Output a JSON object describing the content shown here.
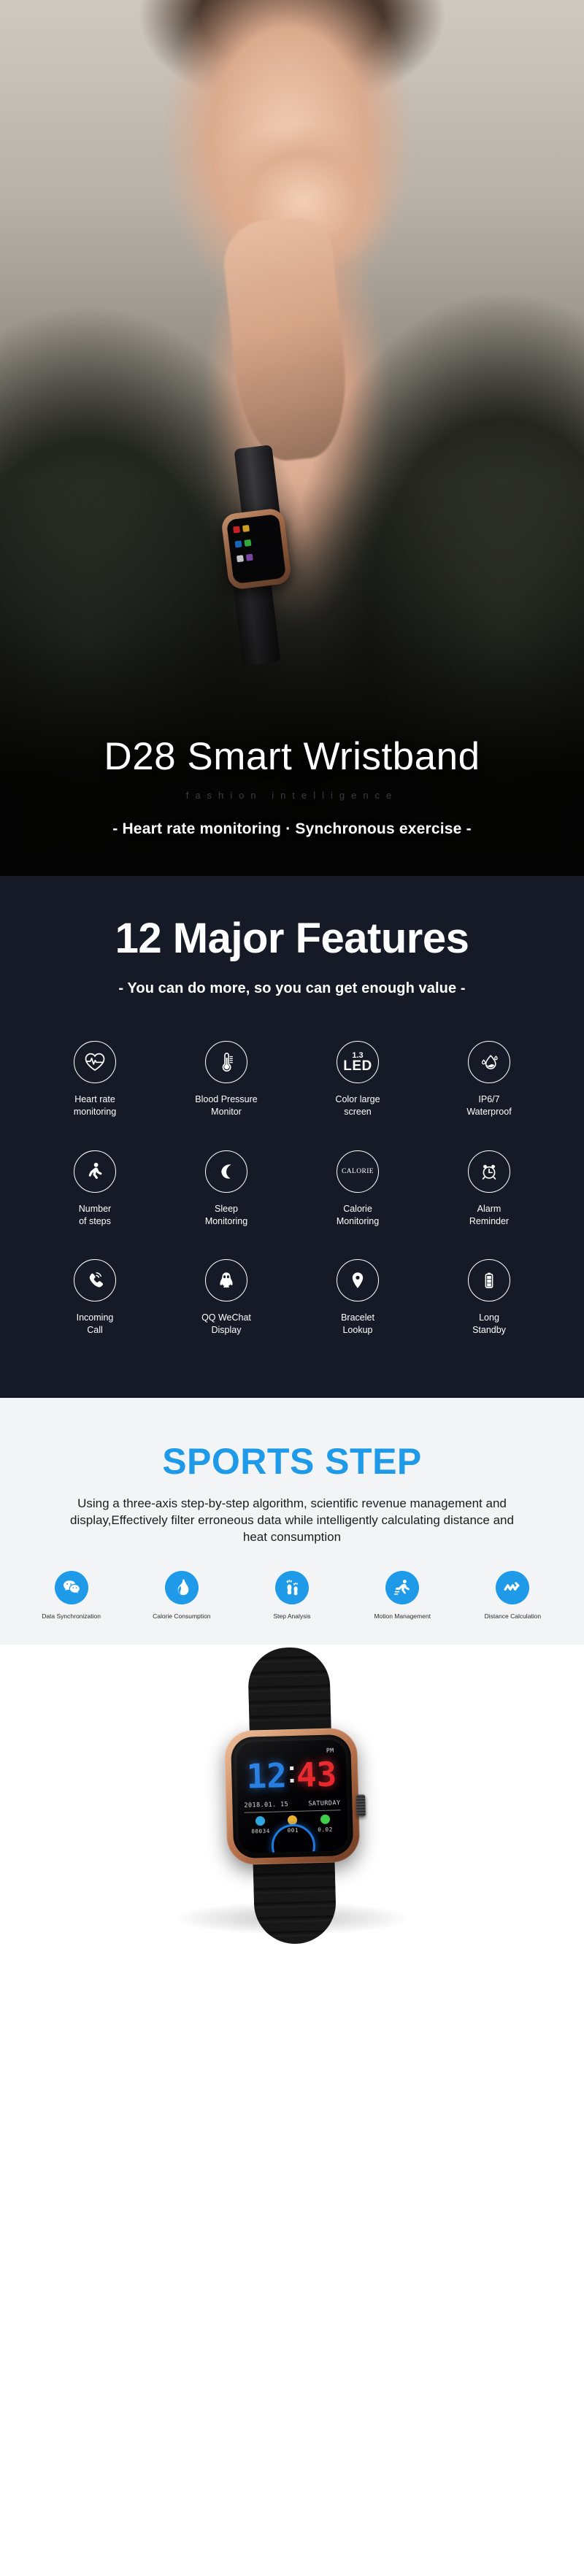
{
  "hero": {
    "title": "D28 Smart Wristband",
    "subtitle_faint": "fashion intelligence",
    "tagline": "- Heart rate monitoring · Synchronous exercise -"
  },
  "features_section": {
    "title": "12 Major Features",
    "subtitle": "- You can do more, so you can get enough value -",
    "background_color": "#151a26",
    "items": [
      {
        "icon": "heart-rate-icon",
        "label": "Heart rate\nmonitoring"
      },
      {
        "icon": "thermometer-icon",
        "label": "Blood Pressure\nMonitor"
      },
      {
        "icon": "led-screen-icon",
        "label": "Color large\nscreen",
        "icon_text_top": "1.3",
        "icon_text_main": "LED"
      },
      {
        "icon": "water-drop-icon",
        "label": "IP6/7\nWaterproof"
      },
      {
        "icon": "walking-person-icon",
        "label": "Number\nof steps"
      },
      {
        "icon": "crescent-moon-icon",
        "label": "Sleep\nMonitoring"
      },
      {
        "icon": "calorie-icon",
        "label": "Calorie\nMonitoring",
        "icon_text_main": "CALORIE"
      },
      {
        "icon": "alarm-clock-icon",
        "label": "Alarm\nReminder"
      },
      {
        "icon": "phone-ringing-icon",
        "label": "Incoming\nCall"
      },
      {
        "icon": "qq-penguin-icon",
        "label": "QQ WeChat\nDisplay"
      },
      {
        "icon": "map-pin-icon",
        "label": "Bracelet\nLookup"
      },
      {
        "icon": "battery-icon",
        "label": "Long\nStandby"
      }
    ]
  },
  "sports_section": {
    "title": "SPORTS STEP",
    "title_color": "#1e9ae8",
    "background_color": "#f3f4f6",
    "paragraph": "Using a three-axis step-by-step algorithm, scientific revenue management and display,Effectively filter erroneous data while intelligently calculating distance and heat consumption",
    "items": [
      {
        "icon": "wechat-icon",
        "label": "Data Synchronization"
      },
      {
        "icon": "flame-icon",
        "label": "Calorie Consumption"
      },
      {
        "icon": "footprints-icon",
        "label": "Step Analysis"
      },
      {
        "icon": "runner-icon",
        "label": "Motion Management"
      },
      {
        "icon": "route-arrow-icon",
        "label": "Distance Calculation"
      }
    ]
  },
  "product_shot": {
    "watch_face": {
      "meridiem": "PM",
      "hour": "12",
      "minute": "43",
      "date": "2018.01. 15",
      "weekday": "SATURDAY",
      "steps_value": "00034",
      "calories_value": "001",
      "distance_value": "0.02",
      "hour_color": "#1f7ae0",
      "minute_color": "#e8262b",
      "steps_icon_color": "#29a8e0",
      "calories_icon_color": "#f0b429",
      "distance_icon_color": "#3ecf4a"
    }
  }
}
